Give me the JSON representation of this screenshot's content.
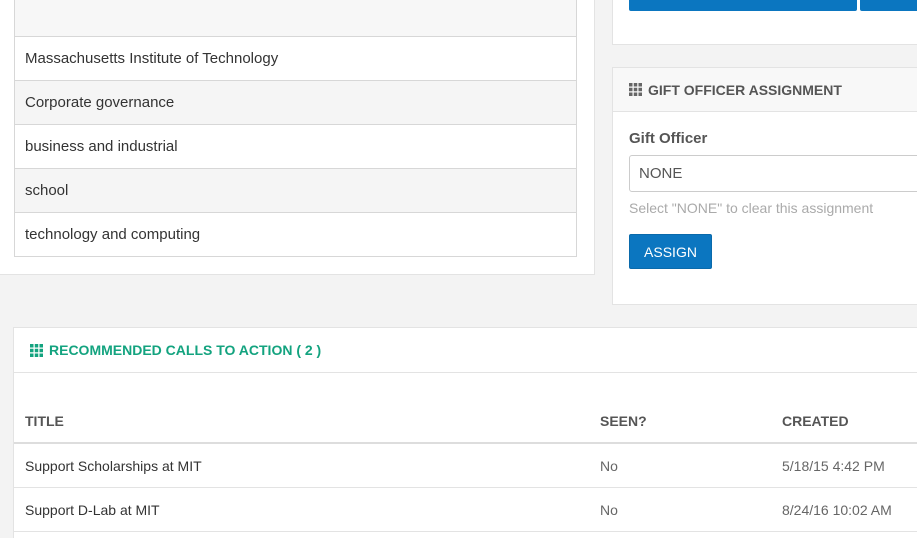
{
  "tags": {
    "items": [
      "",
      "Massachusetts Institute of Technology",
      "Corporate governance",
      "business and industrial",
      "school",
      "technology and computing"
    ]
  },
  "gift_assignment": {
    "title": "GIFT OFFICER ASSIGNMENT",
    "field_label": "Gift Officer",
    "input_value": "NONE",
    "help_text": "Select \"NONE\" to clear this assignment",
    "assign_label": "ASSIGN"
  },
  "cta": {
    "title": "RECOMMENDED CALLS TO ACTION ( 2 )",
    "columns": [
      "TITLE",
      "SEEN?",
      "CREATED"
    ],
    "rows": [
      {
        "title": "Support Scholarships at MIT",
        "seen": "No",
        "created": "5/18/15 4:42 PM"
      },
      {
        "title": "Support D-Lab at MIT",
        "seen": "No",
        "created": "8/24/16 10:02 AM"
      }
    ]
  },
  "colors": {
    "primary": "#0b76c0",
    "accent_green": "#13a37f",
    "background": "#f3f3f3"
  },
  "icons": {
    "section_icon": "grid-icon"
  }
}
